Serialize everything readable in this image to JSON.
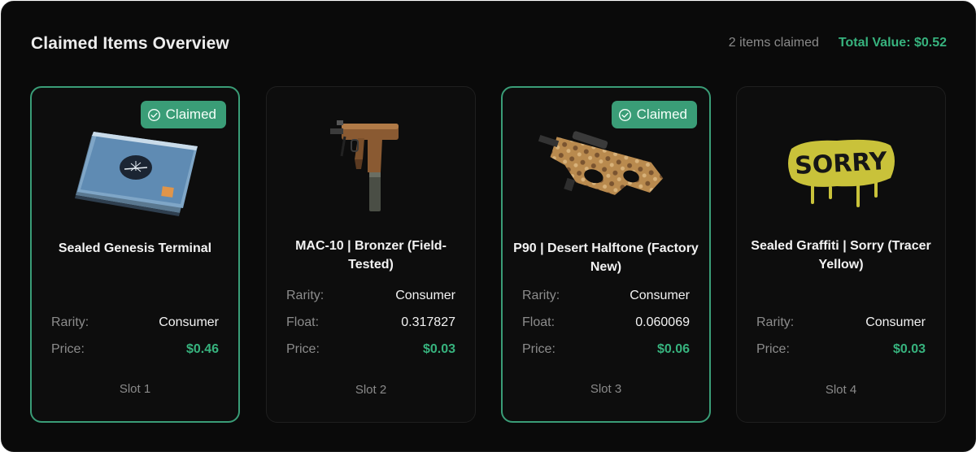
{
  "header": {
    "title": "Claimed Items Overview",
    "items_claimed": "2 items claimed",
    "total_value": "Total Value: $0.52"
  },
  "colors": {
    "background": "#0a0a0a",
    "accent": "#37b37e",
    "claimed_border": "#3a9d77"
  },
  "labels": {
    "rarity": "Rarity:",
    "float": "Float:",
    "price": "Price:",
    "claimed_badge": "Claimed"
  },
  "cards": [
    {
      "name": "Sealed Genesis Terminal",
      "claimed": true,
      "icon": "terminal-case-icon",
      "rarity": "Consumer",
      "price": "$0.46",
      "slot": "Slot 1"
    },
    {
      "name": "MAC-10 | Bronzer (Field-Tested)",
      "claimed": false,
      "icon": "mac10-smg-icon",
      "rarity": "Consumer",
      "float": "0.317827",
      "price": "$0.03",
      "slot": "Slot 2"
    },
    {
      "name": "P90 | Desert Halftone (Factory New)",
      "claimed": true,
      "icon": "p90-smg-icon",
      "rarity": "Consumer",
      "float": "0.060069",
      "price": "$0.06",
      "slot": "Slot 3"
    },
    {
      "name": "Sealed Graffiti | Sorry (Tracer Yellow)",
      "claimed": false,
      "icon": "graffiti-sorry-icon",
      "graffiti_text": "SORRY",
      "rarity": "Consumer",
      "price": "$0.03",
      "slot": "Slot 4"
    }
  ]
}
